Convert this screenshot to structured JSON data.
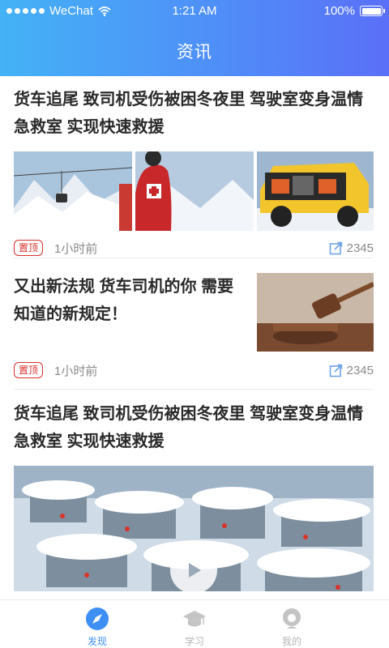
{
  "status_bar": {
    "carrier": "WeChat",
    "time": "1:21 AM",
    "battery": "100%"
  },
  "nav": {
    "title": "资讯"
  },
  "feed": [
    {
      "title": "货车追尾 致司机受伤被困冬夜里 驾驶室变身温情急救室 实现快速救援",
      "tag": "置顶",
      "time": "1小时前",
      "share_count": "2345"
    },
    {
      "title": "又出新法规 货车司机的你 需要知道的新规定！",
      "tag": "置顶",
      "time": "1小时前",
      "share_count": "2345"
    },
    {
      "title": "货车追尾 致司机受伤被困冬夜里 驾驶室变身温情急救室 实现快速救援"
    }
  ],
  "tabbar": {
    "items": [
      {
        "label": "发现",
        "icon": "compass-icon",
        "active": true
      },
      {
        "label": "学习",
        "icon": "graduation-cap-icon",
        "active": false
      },
      {
        "label": "我的",
        "icon": "user-icon",
        "active": false
      }
    ]
  },
  "colors": {
    "header_gradient_start": "#44b2f6",
    "header_gradient_end": "#5a6ff7",
    "accent": "#3d8ff5",
    "tag_red": "#d9302a",
    "muted_text": "#8a8a8a"
  }
}
